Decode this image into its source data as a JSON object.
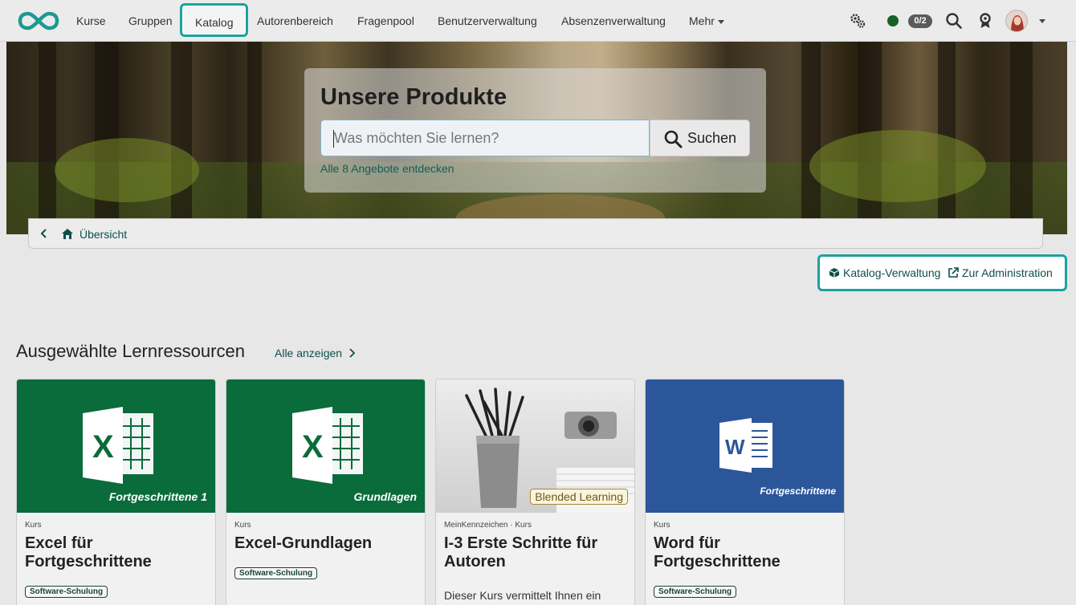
{
  "nav": {
    "items": [
      {
        "label": "Kurse"
      },
      {
        "label": "Gruppen"
      },
      {
        "label": "Katalog"
      },
      {
        "label": "Autorenbereich"
      },
      {
        "label": "Fragenpool"
      },
      {
        "label": "Benutzerverwaltung"
      },
      {
        "label": "Absenzenverwaltung"
      },
      {
        "label": "Mehr"
      }
    ],
    "active": "Katalog",
    "badge": "0/2",
    "icons": [
      "tools-icon",
      "status-dot",
      "search-icon",
      "award-icon",
      "avatar",
      "chevron-down-icon"
    ]
  },
  "hero": {
    "title": "Unsere Produkte",
    "search_placeholder": "Was möchten Sie lernen?",
    "search_button": "Suchen",
    "discover_link": "Alle 8 Angebote entdecken"
  },
  "breadcrumb": {
    "label": "Übersicht"
  },
  "tools": {
    "catalog_admin": "Katalog-Verwaltung",
    "to_admin": "Zur Administration"
  },
  "section": {
    "title": "Ausgewählte Lernressourcen",
    "show_all": "Alle anzeigen"
  },
  "cards": [
    {
      "meta": "Kurs",
      "title": "Excel für Fortgeschrittene",
      "tag": "Software-Schulung",
      "thumb_text": "Fortgeschrittene 1",
      "thumb_color": "#0a6b3b",
      "app_letter": "X"
    },
    {
      "meta": "Kurs",
      "title": "Excel-Grundlagen",
      "tag": "Software-Schulung",
      "thumb_text": "Grundlagen",
      "thumb_color": "#0a6b3b",
      "app_letter": "X"
    },
    {
      "meta": "MeinKennzeichen · Kurs",
      "title": "I-3 Erste Schritte für Autoren",
      "description": "Dieser Kurs vermittelt Ihnen ein",
      "thumb_badge": "Blended Learning",
      "thumb_color": "#d8d8d8"
    },
    {
      "meta": "Kurs",
      "title": "Word für Fortgeschrittene",
      "tag": "Software-Schulung",
      "thumb_text": "Fortgeschrittene",
      "thumb_color": "#2b579a",
      "app_letter": "W"
    }
  ],
  "colors": {
    "accent": "#1aa39e",
    "link": "#0f4f4b",
    "excel": "#0a6b3b",
    "word": "#2b579a"
  }
}
